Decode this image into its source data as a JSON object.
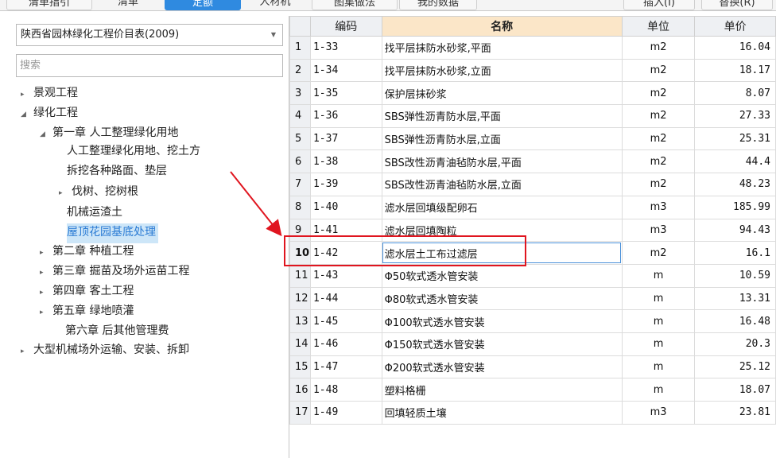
{
  "tabs": [
    "清单指引",
    "清单",
    "定额",
    "人材机",
    "图集做法",
    "我的数据"
  ],
  "top_right_buttons": [
    "插入(I)",
    "替换(R)"
  ],
  "left": {
    "library_selected": "陕西省园林绿化工程价目表(2009)",
    "search_placeholder": "搜索",
    "tree": [
      {
        "label": "景观工程",
        "twisty": "▸"
      },
      {
        "label": "绿化工程",
        "twisty": "◢"
      },
      {
        "label": "第一章 人工整理绿化用地",
        "twisty": "◢"
      },
      {
        "label": "人工整理绿化用地、挖土方",
        "twisty": ""
      },
      {
        "label": "拆挖各种路面、垫层",
        "twisty": ""
      },
      {
        "label": "伐树、挖树根",
        "twisty": "▸"
      },
      {
        "label": "机械运渣土",
        "twisty": ""
      },
      {
        "label": "屋顶花园基底处理",
        "twisty": ""
      },
      {
        "label": "第二章 种植工程",
        "twisty": "▸"
      },
      {
        "label": "第三章 掘苗及场外运苗工程",
        "twisty": "▸"
      },
      {
        "label": "第四章 客土工程",
        "twisty": "▸"
      },
      {
        "label": "第五章 绿地喷灌",
        "twisty": "▸"
      },
      {
        "label": "第六章 后其他管理费",
        "twisty": ""
      },
      {
        "label": "大型机械场外运输、安装、拆卸",
        "twisty": "▸"
      }
    ]
  },
  "table": {
    "headers": [
      "",
      "编码",
      "名称",
      "单位",
      "单价"
    ],
    "rows": [
      {
        "n": "1",
        "code": "1-33",
        "name": "找平层抹防水砂浆,平面",
        "unit": "m2",
        "price": "16.04"
      },
      {
        "n": "2",
        "code": "1-34",
        "name": "找平层抹防水砂浆,立面",
        "unit": "m2",
        "price": "18.17"
      },
      {
        "n": "3",
        "code": "1-35",
        "name": "保护层抹砂浆",
        "unit": "m2",
        "price": "8.07"
      },
      {
        "n": "4",
        "code": "1-36",
        "name": "SBS弹性沥青防水层,平面",
        "unit": "m2",
        "price": "27.33"
      },
      {
        "n": "5",
        "code": "1-37",
        "name": "SBS弹性沥青防水层,立面",
        "unit": "m2",
        "price": "25.31"
      },
      {
        "n": "6",
        "code": "1-38",
        "name": "SBS改性沥青油毡防水层,平面",
        "unit": "m2",
        "price": "44.4"
      },
      {
        "n": "7",
        "code": "1-39",
        "name": "SBS改性沥青油毡防水层,立面",
        "unit": "m2",
        "price": "48.23"
      },
      {
        "n": "8",
        "code": "1-40",
        "name": "滤水层回填级配卵石",
        "unit": "m3",
        "price": "185.99"
      },
      {
        "n": "9",
        "code": "1-41",
        "name": "滤水层回填陶粒",
        "unit": "m3",
        "price": "94.43"
      },
      {
        "n": "10",
        "code": "1-42",
        "name": "滤水层土工布过滤层",
        "unit": "m2",
        "price": "16.1"
      },
      {
        "n": "11",
        "code": "1-43",
        "name": "Φ50软式透水管安装",
        "unit": "m",
        "price": "10.59"
      },
      {
        "n": "12",
        "code": "1-44",
        "name": "Φ80软式透水管安装",
        "unit": "m",
        "price": "13.31"
      },
      {
        "n": "13",
        "code": "1-45",
        "name": "Φ100软式透水管安装",
        "unit": "m",
        "price": "16.48"
      },
      {
        "n": "14",
        "code": "1-46",
        "name": "Φ150软式透水管安装",
        "unit": "m",
        "price": "20.3"
      },
      {
        "n": "15",
        "code": "1-47",
        "name": "Φ200软式透水管安装",
        "unit": "m",
        "price": "25.12"
      },
      {
        "n": "16",
        "code": "1-48",
        "name": "塑料格栅",
        "unit": "m",
        "price": "18.07"
      },
      {
        "n": "17",
        "code": "1-49",
        "name": "回填轻质土壤",
        "unit": "m3",
        "price": "23.81"
      }
    ]
  },
  "colors": {
    "accent": "#2f8ae0",
    "highlight": "#e0151f",
    "selected_bg": "#cde6f8",
    "name_header_bg": "#fbe6c8"
  }
}
